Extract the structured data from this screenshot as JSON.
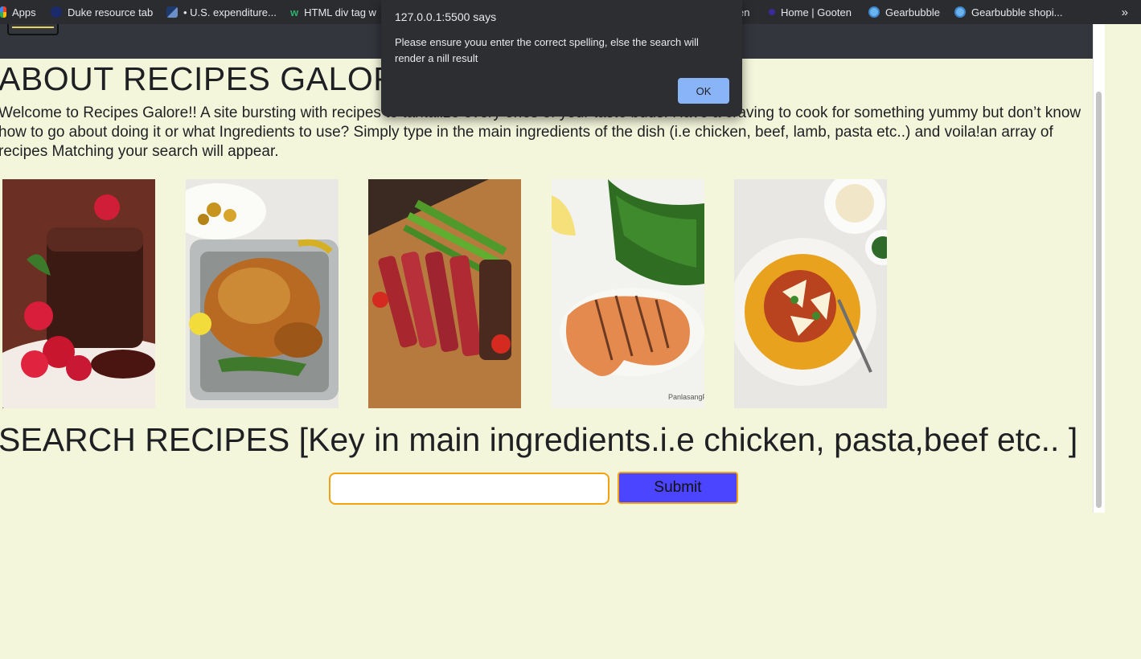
{
  "bookmarks": {
    "items": [
      {
        "label": "Apps",
        "icon": "apps-grid-icon"
      },
      {
        "label": "Duke resource tab",
        "icon": "duke-icon"
      },
      {
        "label": "• U.S. expenditure...",
        "icon": "chart-icon"
      },
      {
        "label": "HTML div tag w",
        "icon": "w3schools-icon"
      },
      {
        "label": "en",
        "icon": ""
      },
      {
        "label": "Home | Gooten",
        "icon": "gooten-icon"
      },
      {
        "label": "Gearbubble",
        "icon": "gearbubble-icon"
      },
      {
        "label": "Gearbubble shopi...",
        "icon": "gearbubble-icon"
      }
    ],
    "more": "»"
  },
  "alert": {
    "title": "127.0.0.1:5500 says",
    "message": "Please ensure youu enter the correct spelling, else the search will render a nill result",
    "ok_label": "OK"
  },
  "about": {
    "heading": "ABOUT RECIPES GALORE!",
    "intro": "Welcome to Recipes Galore!! A site bursting with recipes to tantalize every ones of your taste buds. Have a craving to cook for something yummy but don’t know how to go about doing it or what Ingredients to use? Simply type in the main ingredients of the dish (i.e chicken, beef, lamb, pasta etc..) and voila!an array of recipes Matching your search will appear."
  },
  "gallery": [
    {
      "name": "chocolate-lava-cake-image"
    },
    {
      "name": "roast-chicken-image"
    },
    {
      "name": "sliced-steak-image"
    },
    {
      "name": "grilled-salmon-image",
      "watermark": "PanlasangPin"
    },
    {
      "name": "spaghetti-bolognese-image"
    }
  ],
  "search": {
    "heading": "SEARCH RECIPES [Key in main ingredients.i.e chicken, pasta,beef etc.. ]",
    "input_value": "",
    "input_placeholder": "",
    "submit_label": "Submit"
  },
  "colors": {
    "page_bg": "#f4f6dc",
    "header_bg": "#33363d",
    "submit_bg": "#4b45ff",
    "accent_border": "#f3a111",
    "dialog_bg": "#2d2e31",
    "ok_bg": "#8ab4f8"
  }
}
